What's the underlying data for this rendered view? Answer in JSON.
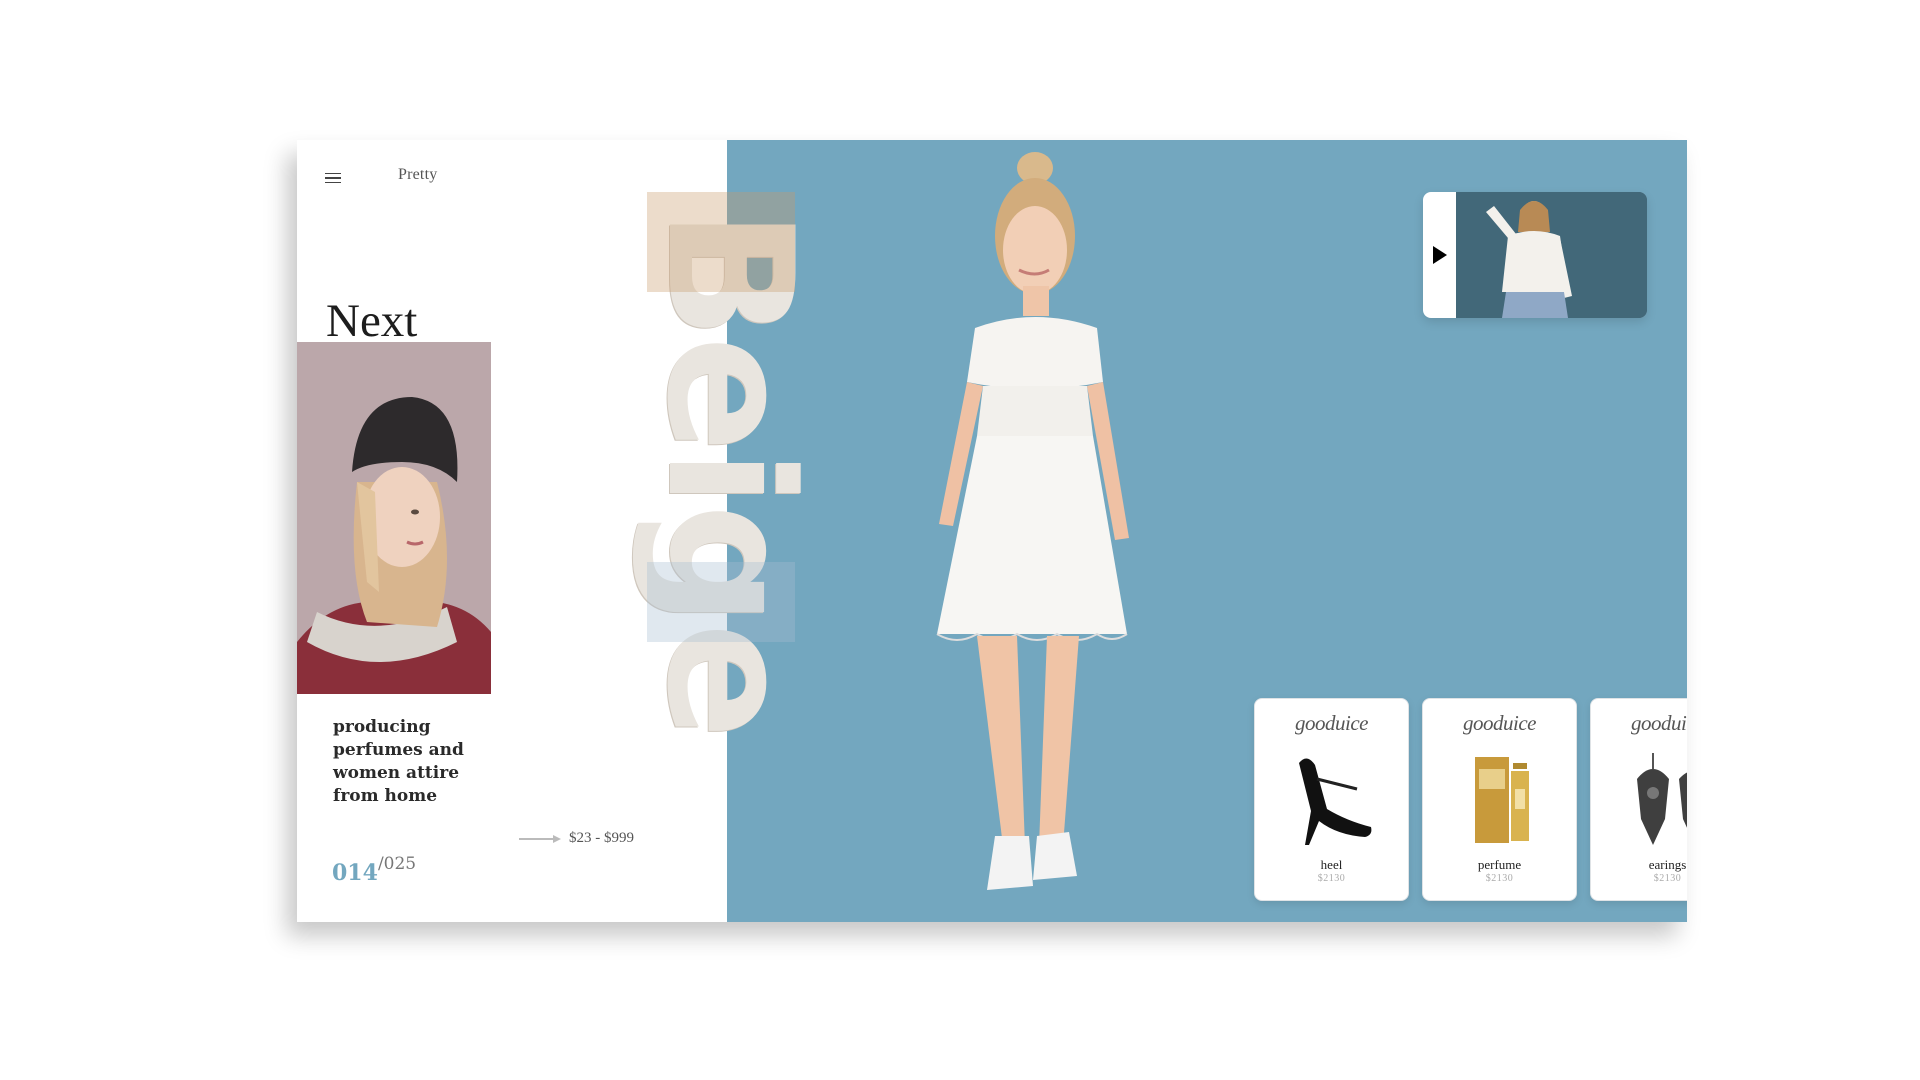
{
  "header": {
    "brand": "Pretty"
  },
  "hero": {
    "heading": "Next",
    "vertical_word": "Beige",
    "tagline": "producing perfumes and women attire from home"
  },
  "price": {
    "range": "$23 - $999"
  },
  "pager": {
    "current": "014",
    "total": "/025"
  },
  "products": [
    {
      "brand": "gooduice",
      "name": "heel",
      "price": "$2130",
      "icon": "heel-icon"
    },
    {
      "brand": "gooduice",
      "name": "perfume",
      "price": "$2130",
      "icon": "perfume-bottle-icon"
    },
    {
      "brand": "gooduice",
      "name": "earings",
      "price": "$2130",
      "icon": "earrings-icon"
    }
  ],
  "colors": {
    "accent": "#73a7bf",
    "video_bg": "#426879",
    "portrait_bg": "#b8a6a9"
  }
}
